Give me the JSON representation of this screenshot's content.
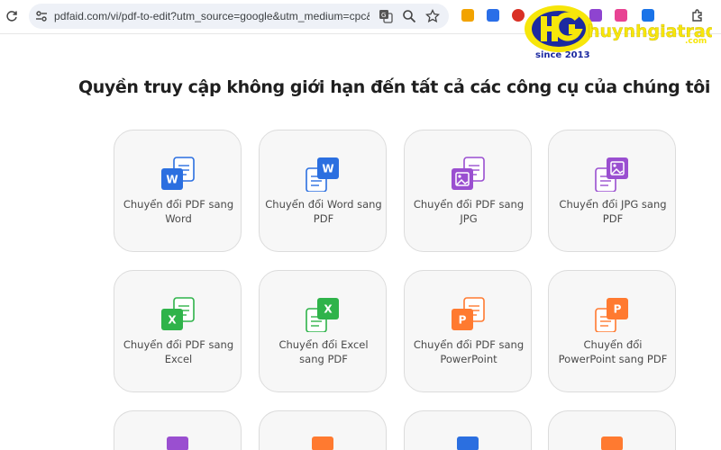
{
  "browser": {
    "url": "pdfaid.com/vi/pdf-to-edit?utm_source=google&utm_medium=cpc&u..."
  },
  "watermark": {
    "brand": "huynhgiatrading",
    "domain": ".com",
    "since": "since 2013"
  },
  "page": {
    "heading": "Quyền truy cập không giới hạn đến tất cả các công cụ của chúng tôi"
  },
  "colors": {
    "word": "#2b6fe0",
    "image": "#9a4fd0",
    "excel": "#2fb34a",
    "powerpoint": "#ff7a30"
  },
  "tools": [
    {
      "label": "Chuyển đổi PDF sang Word",
      "icon": "word-icon"
    },
    {
      "label": "Chuyển đổi Word sang PDF",
      "icon": "word-to-pdf-icon"
    },
    {
      "label": "Chuyển đổi PDF sang JPG",
      "icon": "image-icon"
    },
    {
      "label": "Chuyển đổi JPG sang PDF",
      "icon": "jpg-to-pdf-icon"
    },
    {
      "label": "Chuyển đổi PDF sang Excel",
      "icon": "excel-icon"
    },
    {
      "label": "Chuyển đổi Excel sang PDF",
      "icon": "excel-to-pdf-icon"
    },
    {
      "label": "Chuyển đổi PDF sang PowerPoint",
      "icon": "powerpoint-icon"
    },
    {
      "label": "Chuyển đổi PowerPoint sang PDF",
      "icon": "powerpoint-to-pdf-icon"
    }
  ]
}
